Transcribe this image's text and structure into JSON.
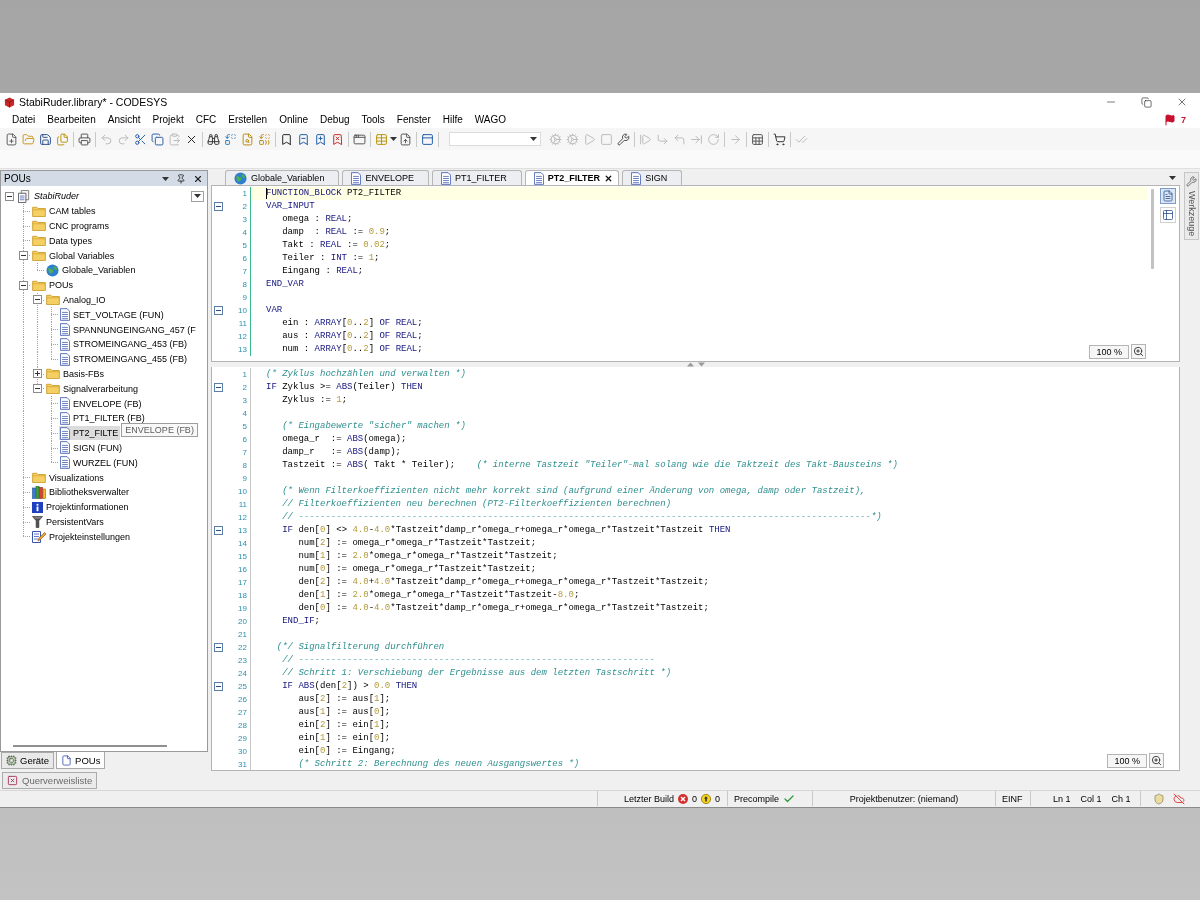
{
  "window": {
    "title": "StabiRuder.library* - CODESYS"
  },
  "menu": [
    "Datei",
    "Bearbeiten",
    "Ansicht",
    "Projekt",
    "CFC",
    "Erstellen",
    "Online",
    "Debug",
    "Tools",
    "Fenster",
    "Hilfe",
    "WAGO"
  ],
  "notifications": "7",
  "toolbar": [
    {
      "kind": "new",
      "disabled": false
    },
    {
      "kind": "open",
      "disabled": false
    },
    {
      "kind": "save",
      "disabled": false
    },
    {
      "kind": "saveall",
      "disabled": false
    },
    {
      "kind": "separator"
    },
    {
      "kind": "print",
      "disabled": false
    },
    {
      "kind": "separator"
    },
    {
      "kind": "undo",
      "disabled": true
    },
    {
      "kind": "redo",
      "disabled": true
    },
    {
      "kind": "cut",
      "disabled": false
    },
    {
      "kind": "copy",
      "disabled": false
    },
    {
      "kind": "paste",
      "disabled": true
    },
    {
      "kind": "delete",
      "disabled": false
    },
    {
      "kind": "separator"
    },
    {
      "kind": "find",
      "disabled": false
    },
    {
      "kind": "replace",
      "disabled": false
    },
    {
      "kind": "findfiles",
      "disabled": false
    },
    {
      "kind": "replacefiles",
      "disabled": false
    },
    {
      "kind": "separator"
    },
    {
      "kind": "bookmark",
      "disabled": false
    },
    {
      "kind": "prevbookmark",
      "disabled": false
    },
    {
      "kind": "nextbookmark",
      "disabled": false
    },
    {
      "kind": "clearbookmarks",
      "disabled": false
    },
    {
      "kind": "separator"
    },
    {
      "kind": "properties",
      "disabled": false
    },
    {
      "kind": "separator"
    },
    {
      "kind": "table",
      "disabled": false
    },
    {
      "kind": "export",
      "disabled": false
    },
    {
      "kind": "separator"
    },
    {
      "kind": "layout",
      "disabled": false
    },
    {
      "kind": "separator"
    },
    {
      "kind": "combo"
    },
    {
      "kind": "login",
      "disabled": true
    },
    {
      "kind": "logout",
      "disabled": true
    },
    {
      "kind": "start",
      "disabled": true
    },
    {
      "kind": "stop",
      "disabled": true
    },
    {
      "kind": "tools",
      "disabled": false
    },
    {
      "kind": "separator"
    },
    {
      "kind": "stepover",
      "disabled": true
    },
    {
      "kind": "stepinto",
      "disabled": true
    },
    {
      "kind": "stepout",
      "disabled": true
    },
    {
      "kind": "runtocursor",
      "disabled": true
    },
    {
      "kind": "setnext",
      "disabled": true
    },
    {
      "kind": "separator"
    },
    {
      "kind": "forward",
      "disabled": true
    },
    {
      "kind": "separator"
    },
    {
      "kind": "grid",
      "disabled": false
    },
    {
      "kind": "separator"
    },
    {
      "kind": "cart",
      "disabled": false
    },
    {
      "kind": "separator"
    },
    {
      "kind": "checklist",
      "disabled": true
    }
  ],
  "pou_panel": {
    "title": "POUs",
    "items": [
      {
        "label": "StabiRuder",
        "kind": "project",
        "expanded": true,
        "selected": false,
        "children": [
          {
            "label": "CAM tables",
            "kind": "folder",
            "selected": false
          },
          {
            "label": "CNC programs",
            "kind": "folder",
            "selected": false
          },
          {
            "label": "Data types",
            "kind": "folder",
            "selected": false
          },
          {
            "label": "Global Variables",
            "kind": "folder",
            "expanded": true,
            "selected": false,
            "children": [
              {
                "label": "Globale_Variablen",
                "kind": "gvl",
                "selected": false
              }
            ]
          },
          {
            "label": "POUs",
            "kind": "folder",
            "expanded": true,
            "selected": false,
            "children": [
              {
                "label": "Analog_IO",
                "kind": "folder",
                "expanded": true,
                "selected": false,
                "children": [
                  {
                    "label": "SET_VOLTAGE (FUN)",
                    "kind": "pou",
                    "selected": false
                  },
                  {
                    "label": "SPANNUNGEINGANG_457 (F",
                    "kind": "pou",
                    "selected": false
                  },
                  {
                    "label": "STROMEINGANG_453 (FB)",
                    "kind": "pou",
                    "selected": false
                  },
                  {
                    "label": "STROMEINGANG_455 (FB)",
                    "kind": "pou",
                    "selected": false
                  }
                ]
              },
              {
                "label": "Basis-FBs",
                "kind": "folder",
                "expanded": false,
                "selected": false
              },
              {
                "label": "Signalverarbeitung",
                "kind": "folder",
                "expanded": true,
                "selected": false,
                "children": [
                  {
                    "label": "ENVELOPE (FB)",
                    "kind": "pou",
                    "selected": false
                  },
                  {
                    "label": "PT1_FILTER (FB)",
                    "kind": "pou",
                    "selected": false
                  },
                  {
                    "label": "PT2_FILTE",
                    "kind": "pou",
                    "selected": true,
                    "tooltip": "ENVELOPE (FB)"
                  },
                  {
                    "label": "SIGN (FUN)",
                    "kind": "pou",
                    "selected": false
                  },
                  {
                    "label": "WURZEL (FUN)",
                    "kind": "pou",
                    "selected": false
                  }
                ]
              }
            ]
          },
          {
            "label": "Visualizations",
            "kind": "folder",
            "selected": false
          },
          {
            "label": "Bibliotheksverwalter",
            "kind": "library",
            "selected": false
          },
          {
            "label": "Projektinformationen",
            "kind": "info",
            "selected": false
          },
          {
            "label": "PersistentVars",
            "kind": "persistent",
            "selected": false
          },
          {
            "label": "Projekteinstellungen",
            "kind": "settings",
            "selected": false
          }
        ]
      }
    ],
    "tabs": [
      {
        "label": "Geräte",
        "kind": "devices",
        "selected": false
      },
      {
        "label": "POUs",
        "kind": "pous",
        "selected": true
      }
    ]
  },
  "editor_tabs": [
    {
      "label": "Globale_Variablen",
      "kind": "gvl",
      "selected": false
    },
    {
      "label": "ENVELOPE",
      "kind": "pou",
      "selected": false
    },
    {
      "label": "PT1_FILTER",
      "kind": "pou",
      "selected": false
    },
    {
      "label": "PT2_FILTER",
      "kind": "pou",
      "selected": true
    },
    {
      "label": "SIGN",
      "kind": "pou",
      "selected": false
    }
  ],
  "declaration_editor": {
    "views": [
      {
        "kind": "text",
        "selected": true
      },
      {
        "kind": "table",
        "selected": false
      }
    ],
    "zoom": "100 %",
    "lines": [
      {
        "number": "1",
        "fold": false,
        "current": true,
        "tokens": [
          {
            "kind": "keyword",
            "text": "FUNCTION_BLOCK"
          },
          {
            "kind": "plain",
            "text": " PT2_FILTER"
          }
        ]
      },
      {
        "number": "2",
        "fold": true,
        "current": false,
        "tokens": [
          {
            "kind": "keyword",
            "text": "VAR_INPUT"
          }
        ]
      },
      {
        "number": "3",
        "fold": false,
        "current": false,
        "tokens": [
          {
            "kind": "plain",
            "text": "   omega : "
          },
          {
            "kind": "keyword",
            "text": "REAL"
          },
          {
            "kind": "plain",
            "text": ";"
          }
        ]
      },
      {
        "number": "4",
        "fold": false,
        "current": false,
        "tokens": [
          {
            "kind": "plain",
            "text": "   damp  : "
          },
          {
            "kind": "keyword",
            "text": "REAL"
          },
          {
            "kind": "plain",
            "text": " := "
          },
          {
            "kind": "number",
            "text": "0.9"
          },
          {
            "kind": "plain",
            "text": ";"
          }
        ]
      },
      {
        "number": "5",
        "fold": false,
        "current": false,
        "tokens": [
          {
            "kind": "plain",
            "text": "   Takt : "
          },
          {
            "kind": "keyword",
            "text": "REAL"
          },
          {
            "kind": "plain",
            "text": " := "
          },
          {
            "kind": "number",
            "text": "0.02"
          },
          {
            "kind": "plain",
            "text": ";"
          }
        ]
      },
      {
        "number": "6",
        "fold": false,
        "current": false,
        "tokens": [
          {
            "kind": "plain",
            "text": "   Teiler : "
          },
          {
            "kind": "keyword",
            "text": "INT"
          },
          {
            "kind": "plain",
            "text": " := "
          },
          {
            "kind": "number",
            "text": "1"
          },
          {
            "kind": "plain",
            "text": ";"
          }
        ]
      },
      {
        "number": "7",
        "fold": false,
        "current": false,
        "tokens": [
          {
            "kind": "plain",
            "text": "   Eingang : "
          },
          {
            "kind": "keyword",
            "text": "REAL"
          },
          {
            "kind": "plain",
            "text": ";"
          }
        ]
      },
      {
        "number": "8",
        "fold": false,
        "current": false,
        "tokens": [
          {
            "kind": "keyword",
            "text": "END_VAR"
          }
        ]
      },
      {
        "number": "9",
        "fold": false,
        "current": false
      },
      {
        "number": "10",
        "fold": true,
        "current": false,
        "tokens": [
          {
            "kind": "keyword",
            "text": "VAR"
          }
        ]
      },
      {
        "number": "11",
        "fold": false,
        "current": false,
        "tokens": [
          {
            "kind": "plain",
            "text": "   ein : "
          },
          {
            "kind": "keyword",
            "text": "ARRAY"
          },
          {
            "kind": "plain",
            "text": "["
          },
          {
            "kind": "number",
            "text": "0"
          },
          {
            "kind": "plain",
            "text": ".."
          },
          {
            "kind": "number",
            "text": "2"
          },
          {
            "kind": "plain",
            "text": "] "
          },
          {
            "kind": "keyword",
            "text": "OF REAL"
          },
          {
            "kind": "plain",
            "text": ";"
          }
        ]
      },
      {
        "number": "12",
        "fold": false,
        "current": false,
        "tokens": [
          {
            "kind": "plain",
            "text": "   aus : "
          },
          {
            "kind": "keyword",
            "text": "ARRAY"
          },
          {
            "kind": "plain",
            "text": "["
          },
          {
            "kind": "number",
            "text": "0"
          },
          {
            "kind": "plain",
            "text": ".."
          },
          {
            "kind": "number",
            "text": "2"
          },
          {
            "kind": "plain",
            "text": "] "
          },
          {
            "kind": "keyword",
            "text": "OF REAL"
          },
          {
            "kind": "plain",
            "text": ";"
          }
        ]
      },
      {
        "number": "13",
        "fold": false,
        "current": false,
        "tokens": [
          {
            "kind": "plain",
            "text": "   num : "
          },
          {
            "kind": "keyword",
            "text": "ARRAY"
          },
          {
            "kind": "plain",
            "text": "["
          },
          {
            "kind": "number",
            "text": "0"
          },
          {
            "kind": "plain",
            "text": ".."
          },
          {
            "kind": "number",
            "text": "2"
          },
          {
            "kind": "plain",
            "text": "] "
          },
          {
            "kind": "keyword",
            "text": "OF REAL"
          },
          {
            "kind": "plain",
            "text": ";"
          }
        ]
      }
    ]
  },
  "implementation_editor": {
    "zoom": "100 %",
    "lines": [
      {
        "number": "1",
        "fold": false,
        "current": false,
        "tokens": [
          {
            "kind": "comment",
            "text": "(* Zyklus hochzählen und verwalten *)"
          }
        ]
      },
      {
        "number": "2",
        "fold": true,
        "current": false,
        "tokens": [
          {
            "kind": "keyword",
            "text": "IF"
          },
          {
            "kind": "plain",
            "text": " Zyklus >= "
          },
          {
            "kind": "keyword",
            "text": "ABS"
          },
          {
            "kind": "plain",
            "text": "(Teiler) "
          },
          {
            "kind": "keyword",
            "text": "THEN"
          }
        ]
      },
      {
        "number": "3",
        "fold": false,
        "current": false,
        "tokens": [
          {
            "kind": "plain",
            "text": "   Zyklus := "
          },
          {
            "kind": "number",
            "text": "1"
          },
          {
            "kind": "plain",
            "text": ";"
          }
        ]
      },
      {
        "number": "4",
        "fold": false,
        "current": false
      },
      {
        "number": "5",
        "fold": false,
        "current": false,
        "tokens": [
          {
            "kind": "comment",
            "text": "   (* Eingabewerte \"sicher\" machen *)"
          }
        ]
      },
      {
        "number": "6",
        "fold": false,
        "current": false,
        "tokens": [
          {
            "kind": "plain",
            "text": "   omega_r  := "
          },
          {
            "kind": "keyword",
            "text": "ABS"
          },
          {
            "kind": "plain",
            "text": "(omega);"
          }
        ]
      },
      {
        "number": "7",
        "fold": false,
        "current": false,
        "tokens": [
          {
            "kind": "plain",
            "text": "   damp_r   := "
          },
          {
            "kind": "keyword",
            "text": "ABS"
          },
          {
            "kind": "plain",
            "text": "(damp);"
          }
        ]
      },
      {
        "number": "8",
        "fold": false,
        "current": false,
        "tokens": [
          {
            "kind": "plain",
            "text": "   Tastzeit := "
          },
          {
            "kind": "keyword",
            "text": "ABS"
          },
          {
            "kind": "plain",
            "text": "( Takt * Teiler);    "
          },
          {
            "kind": "comment",
            "text": "(* interne Tastzeit \"Teiler\"-mal solang wie die Taktzeit des Takt-Bausteins *)"
          }
        ]
      },
      {
        "number": "9",
        "fold": false,
        "current": false
      },
      {
        "number": "10",
        "fold": false,
        "current": false,
        "tokens": [
          {
            "kind": "comment",
            "text": "   (* Wenn Filterkoeffizienten nicht mehr korrekt sind (aufgrund einer Änderung von omega, damp oder Tastzeit),"
          }
        ]
      },
      {
        "number": "11",
        "fold": false,
        "current": false,
        "tokens": [
          {
            "kind": "comment",
            "text": "   // Filterkoeffizienten neu berechnen (PT2-Filterkoeffizienten berechnen)"
          }
        ]
      },
      {
        "number": "12",
        "fold": false,
        "current": false,
        "tokens": [
          {
            "kind": "comment",
            "text": "   // ----------------------------------------------------------------------------------------------------------*)"
          }
        ]
      },
      {
        "number": "13",
        "fold": true,
        "current": false,
        "tokens": [
          {
            "kind": "keyword",
            "text": "   IF"
          },
          {
            "kind": "plain",
            "text": " den["
          },
          {
            "kind": "number",
            "text": "0"
          },
          {
            "kind": "plain",
            "text": "] <> "
          },
          {
            "kind": "number",
            "text": "4.0"
          },
          {
            "kind": "plain",
            "text": "-"
          },
          {
            "kind": "number",
            "text": "4.0"
          },
          {
            "kind": "plain",
            "text": "*Tastzeit*damp_r*omega_r+omega_r*omega_r*Tastzeit*Tastzeit "
          },
          {
            "kind": "keyword",
            "text": "THEN"
          }
        ]
      },
      {
        "number": "14",
        "fold": false,
        "current": false,
        "tokens": [
          {
            "kind": "plain",
            "text": "      num["
          },
          {
            "kind": "number",
            "text": "2"
          },
          {
            "kind": "plain",
            "text": "] := omega_r*omega_r*Tastzeit*Tastzeit;"
          }
        ]
      },
      {
        "number": "15",
        "fold": false,
        "current": false,
        "tokens": [
          {
            "kind": "plain",
            "text": "      num["
          },
          {
            "kind": "number",
            "text": "1"
          },
          {
            "kind": "plain",
            "text": "] := "
          },
          {
            "kind": "number",
            "text": "2.0"
          },
          {
            "kind": "plain",
            "text": "*omega_r*omega_r*Tastzeit*Tastzeit;"
          }
        ]
      },
      {
        "number": "16",
        "fold": false,
        "current": false,
        "tokens": [
          {
            "kind": "plain",
            "text": "      num["
          },
          {
            "kind": "number",
            "text": "0"
          },
          {
            "kind": "plain",
            "text": "] := omega_r*omega_r*Tastzeit*Tastzeit;"
          }
        ]
      },
      {
        "number": "17",
        "fold": false,
        "current": false,
        "tokens": [
          {
            "kind": "plain",
            "text": "      den["
          },
          {
            "kind": "number",
            "text": "2"
          },
          {
            "kind": "plain",
            "text": "] := "
          },
          {
            "kind": "number",
            "text": "4.0"
          },
          {
            "kind": "plain",
            "text": "+"
          },
          {
            "kind": "number",
            "text": "4.0"
          },
          {
            "kind": "plain",
            "text": "*Tastzeit*damp_r*omega_r+omega_r*omega_r*Tastzeit*Tastzeit;"
          }
        ]
      },
      {
        "number": "18",
        "fold": false,
        "current": false,
        "tokens": [
          {
            "kind": "plain",
            "text": "      den["
          },
          {
            "kind": "number",
            "text": "1"
          },
          {
            "kind": "plain",
            "text": "] := "
          },
          {
            "kind": "number",
            "text": "2.0"
          },
          {
            "kind": "plain",
            "text": "*omega_r*omega_r*Tastzeit*Tastzeit-"
          },
          {
            "kind": "number",
            "text": "8.0"
          },
          {
            "kind": "plain",
            "text": ";"
          }
        ]
      },
      {
        "number": "19",
        "fold": false,
        "current": false,
        "tokens": [
          {
            "kind": "plain",
            "text": "      den["
          },
          {
            "kind": "number",
            "text": "0"
          },
          {
            "kind": "plain",
            "text": "] := "
          },
          {
            "kind": "number",
            "text": "4.0"
          },
          {
            "kind": "plain",
            "text": "-"
          },
          {
            "kind": "number",
            "text": "4.0"
          },
          {
            "kind": "plain",
            "text": "*Tastzeit*damp_r*omega_r+omega_r*omega_r*Tastzeit*Tastzeit;"
          }
        ]
      },
      {
        "number": "20",
        "fold": false,
        "current": false,
        "tokens": [
          {
            "kind": "keyword",
            "text": "   END_IF"
          },
          {
            "kind": "plain",
            "text": ";"
          }
        ]
      },
      {
        "number": "21",
        "fold": false,
        "current": false
      },
      {
        "number": "22",
        "fold": true,
        "current": false,
        "tokens": [
          {
            "kind": "comment",
            "text": "  (*/ Signalfilterung durchführen"
          }
        ]
      },
      {
        "number": "23",
        "fold": false,
        "current": false,
        "tokens": [
          {
            "kind": "comment",
            "text": "   // ------------------------------------------------------------------"
          }
        ]
      },
      {
        "number": "24",
        "fold": false,
        "current": false,
        "tokens": [
          {
            "kind": "comment",
            "text": "   // Schritt 1: Verschiebung der Ergebnisse aus dem letzten Tastschritt *)"
          }
        ]
      },
      {
        "number": "25",
        "fold": true,
        "current": false,
        "tokens": [
          {
            "kind": "keyword",
            "text": "   IF ABS"
          },
          {
            "kind": "plain",
            "text": "(den["
          },
          {
            "kind": "number",
            "text": "2"
          },
          {
            "kind": "plain",
            "text": "]) > "
          },
          {
            "kind": "number",
            "text": "0.0"
          },
          {
            "kind": "keyword",
            "text": " THEN"
          }
        ]
      },
      {
        "number": "26",
        "fold": false,
        "current": false,
        "tokens": [
          {
            "kind": "plain",
            "text": "      aus["
          },
          {
            "kind": "number",
            "text": "2"
          },
          {
            "kind": "plain",
            "text": "] := aus["
          },
          {
            "kind": "number",
            "text": "1"
          },
          {
            "kind": "plain",
            "text": "];"
          }
        ]
      },
      {
        "number": "27",
        "fold": false,
        "current": false,
        "tokens": [
          {
            "kind": "plain",
            "text": "      aus["
          },
          {
            "kind": "number",
            "text": "1"
          },
          {
            "kind": "plain",
            "text": "] := aus["
          },
          {
            "kind": "number",
            "text": "0"
          },
          {
            "kind": "plain",
            "text": "];"
          }
        ]
      },
      {
        "number": "28",
        "fold": false,
        "current": false,
        "tokens": [
          {
            "kind": "plain",
            "text": "      ein["
          },
          {
            "kind": "number",
            "text": "2"
          },
          {
            "kind": "plain",
            "text": "] := ein["
          },
          {
            "kind": "number",
            "text": "1"
          },
          {
            "kind": "plain",
            "text": "];"
          }
        ]
      },
      {
        "number": "29",
        "fold": false,
        "current": false,
        "tokens": [
          {
            "kind": "plain",
            "text": "      ein["
          },
          {
            "kind": "number",
            "text": "1"
          },
          {
            "kind": "plain",
            "text": "] := ein["
          },
          {
            "kind": "number",
            "text": "0"
          },
          {
            "kind": "plain",
            "text": "];"
          }
        ]
      },
      {
        "number": "30",
        "fold": false,
        "current": false,
        "tokens": [
          {
            "kind": "plain",
            "text": "      ein["
          },
          {
            "kind": "number",
            "text": "0"
          },
          {
            "kind": "plain",
            "text": "] := Eingang;"
          }
        ]
      },
      {
        "number": "31",
        "fold": false,
        "current": false,
        "tokens": [
          {
            "kind": "comment",
            "text": "      (* Schritt 2: Berechnung des neuen Ausgangswertes *)"
          }
        ]
      }
    ]
  },
  "side_tab": "Werkzeuge",
  "dock_tabs": [
    {
      "label": "Querverweisliste"
    }
  ],
  "status_bar": {
    "build_label": "Letzter Build",
    "errors": "0",
    "warnings": "0",
    "precompile_label": "Precompile",
    "precompile_ok": true,
    "user": "Projektbenutzer: (niemand)",
    "mode": "EINF",
    "line": "Ln 1",
    "column": "Col 1",
    "char": "Ch 1"
  }
}
